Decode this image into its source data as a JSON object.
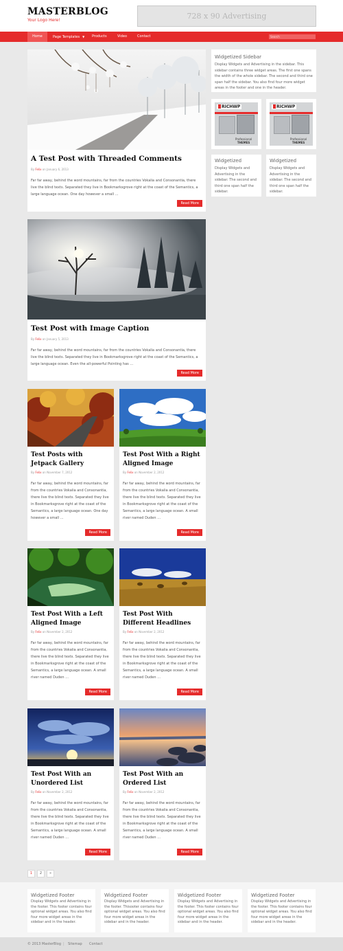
{
  "site": {
    "title": "MASTERBLOG",
    "tagline": "Your Logo Here!"
  },
  "ad": {
    "label": "728 x 90 Advertising"
  },
  "nav": {
    "items": [
      {
        "label": "Home"
      },
      {
        "label": "Page Templates"
      },
      {
        "label": "Products"
      },
      {
        "label": "Video"
      },
      {
        "label": "Contact"
      }
    ],
    "search_placeholder": "Search"
  },
  "posts": [
    {
      "title": "A Test Post with Threaded Comments",
      "author": "Felix",
      "date": "on January 6, 2013",
      "by": "By",
      "excerpt": "Far far away, behind the word mountains, far from the countries Vokalia and Consonantia, there live the blind texts. Separated they live in Bookmarksgrove right at the coast of the Semantics, a large language ocean. One day however a small …",
      "more": "Read More"
    },
    {
      "title": "Test Post with Image Caption",
      "author": "Felix",
      "date": "on January 5, 2013",
      "by": "By",
      "excerpt": "Far far away, behind the word mountains, far from the countries Vokalia and Consonantia, there live the blind texts. Separated they live in Bookmarksgrove right at the coast of the Semantics, a large language ocean. Even the all-powerful Pointing has …",
      "more": "Read More"
    },
    {
      "title": "Test Posts with Jetpack Gallery",
      "author": "Felix",
      "date": "on November 7, 2012",
      "by": "By",
      "excerpt": "Far far away, behind the word mountains, far from the countries Vokalia and Consonantia, there live the blind texts. Separated they live in Bookmarksgrove right at the coast of the Semantics, a large language ocean. One day however a small …",
      "more": "Read More"
    },
    {
      "title": "Test Post With a Right Aligned Image",
      "author": "Felix",
      "date": "on November 2, 2012",
      "by": "By",
      "excerpt": "Far far away, behind the word mountains, far from the countries Vokalia and Consonantia, there live the blind texts. Separated they live in Bookmarksgrove right at the coast of the Semantics, a large language ocean. A small river named Duden …",
      "more": "Read More"
    },
    {
      "title": "Test Post With a Left Aligned Image",
      "author": "Felix",
      "date": "on November 2, 2012",
      "by": "By",
      "excerpt": "Far far away, behind the word mountains, far from the countries Vokalia and Consonantia, there live the blind texts. Separated they live in Bookmarksgrove right at the coast of the Semantics, a large language ocean. A small river named Duden …",
      "more": "Read More"
    },
    {
      "title": "Test Post With Different Headlines",
      "author": "Felix",
      "date": "on November 2, 2012",
      "by": "By",
      "excerpt": "Far far away, behind the word mountains, far from the countries Vokalia and Consonantia, there live the blind texts. Separated they live in Bookmarksgrove right at the coast of the Semantics, a large language ocean. A small river named Duden …",
      "more": "Read More"
    },
    {
      "title": "Test Post With an Unordered List",
      "author": "Felix",
      "date": "on November 2, 2012",
      "by": "By",
      "excerpt": "Far far away, behind the word mountains, far from the countries Vokalia and Consonantia, there live the blind texts. Separated they live in Bookmarksgrove right at the coast of the Semantics, a large language ocean. A small river named Duden …",
      "more": "Read More"
    },
    {
      "title": "Test Post With an Ordered List",
      "author": "Felix",
      "date": "on November 2, 2012",
      "by": "By",
      "excerpt": "Far far away, behind the word mountains, far from the countries Vokalia and Consonantia, there live the blind texts. Separated they live in Bookmarksgrove right at the coast of the Semantics, a large language ocean. A small river named Duden …",
      "more": "Read More"
    }
  ],
  "sidebar": {
    "main": {
      "title": "Widgetized Sidebar",
      "text": "Display Widgets and Advertising in the sidebar. This sidebar contains three widget areas. The first one spans the width of the whole sidebar. The second and third one span half the sidebar. You also find four more widget areas in the footer and one in the header."
    },
    "ads": [
      {
        "logo": "RICHWP",
        "line1": "Professional",
        "line2": "THEMES"
      },
      {
        "logo": "RICHWP",
        "line1": "Professional",
        "line2": "THEMES"
      }
    ],
    "half": [
      {
        "title": "Widgetized",
        "text": "Display Widgets and Advertising in the sidebar. The second and third one span half the sidebar."
      },
      {
        "title": "Widgetized",
        "text": "Display Widgets and Advertising in the sidebar. The second and third one span half the sidebar."
      }
    ]
  },
  "pagination": {
    "pages": [
      "1",
      "2",
      "»"
    ]
  },
  "footer": {
    "widgets": [
      {
        "title": "Widgetized Footer",
        "text": "Display Widgets and Advertising in the footer. This footer contains four optional widget areas. You also find four more widget areas in the sidebar and in the header."
      },
      {
        "title": "Widgetized Footer",
        "text": "Display Widgets and Advertising in the footer. Thisooter contains four optional widget areas. You also find four more widget areas in the sidebar and in the header."
      },
      {
        "title": "Widgetized Footer",
        "text": "Display Widgets and Advertising in the footer. This footer contains four optional widget areas. You also find four more widget areas in the sidebar and in the header."
      },
      {
        "title": "Widgetized Footer",
        "text": "Display Widgets and Advertising in the footer. This footer contains four optional widget areas. You also find four more widget areas in the sidebar and in the header."
      }
    ],
    "copyright": "© 2013 MasterBlog",
    "sep": "|",
    "links": [
      "Sitemap",
      "Contact"
    ]
  },
  "colors": {
    "accent": "#e52b2b",
    "background": "#e9e9e9",
    "card": "#ffffff"
  }
}
